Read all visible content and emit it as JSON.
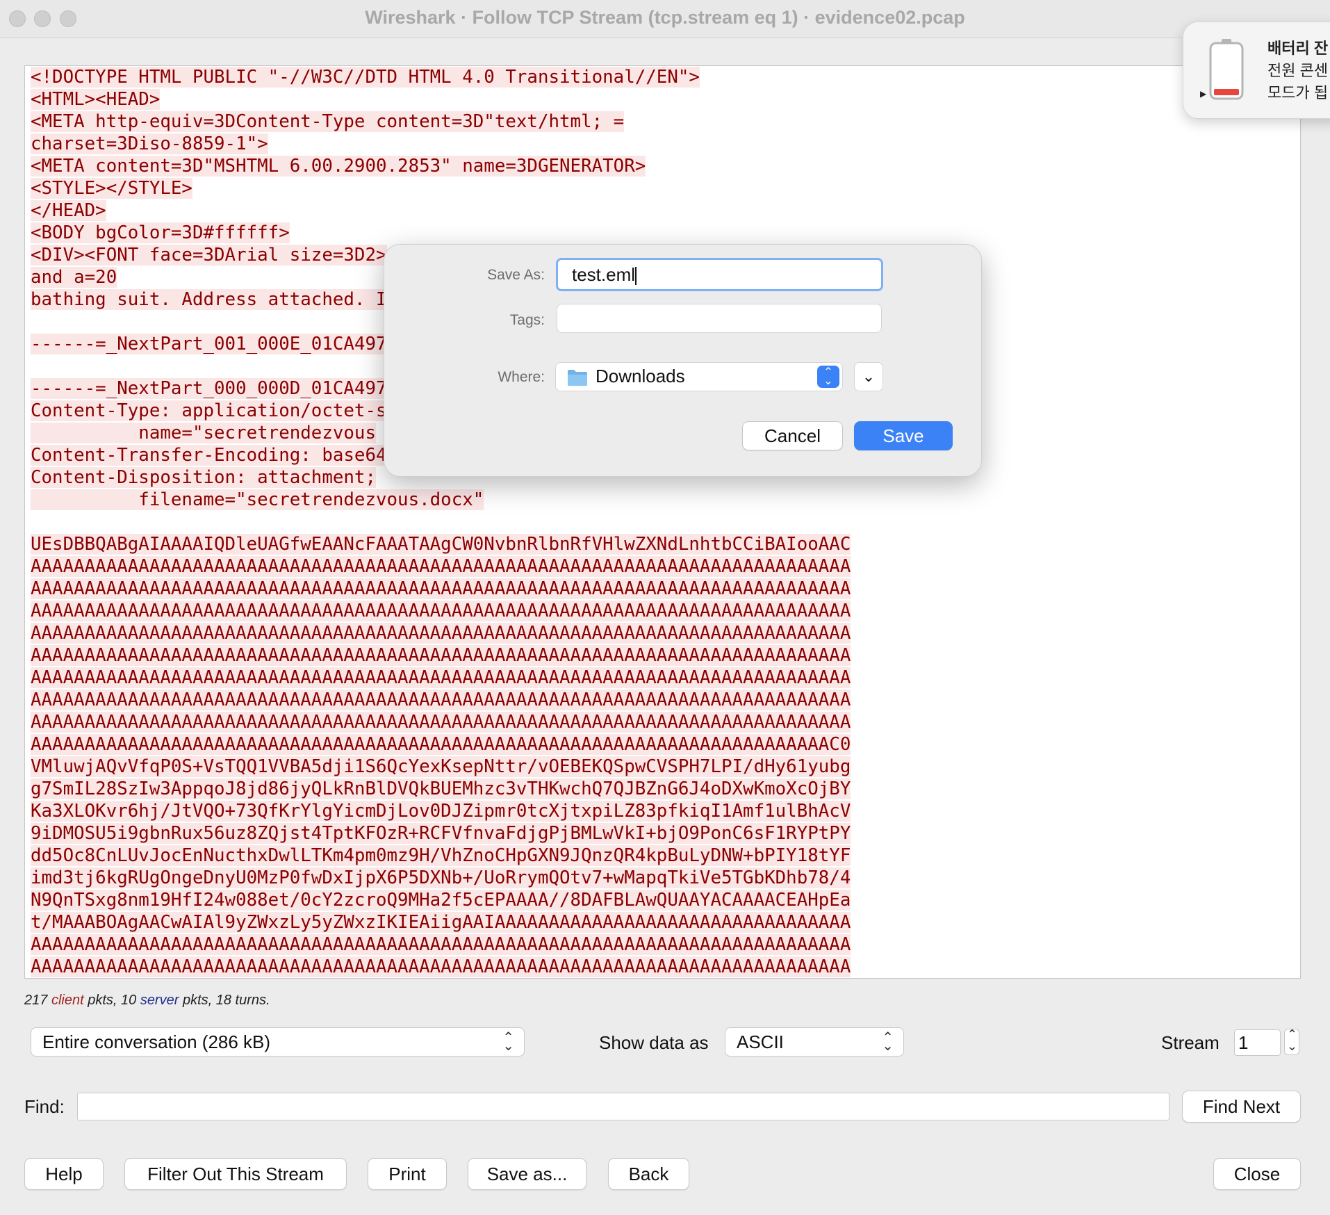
{
  "window": {
    "title": "Wireshark · Follow TCP Stream (tcp.stream eq 1) · evidence02.pcap"
  },
  "stream": {
    "lines": [
      {
        "text": "<!DOCTYPE HTML PUBLIC \"-//W3C//DTD HTML 4.0 Transitional//EN\">",
        "hl": true
      },
      {
        "text": "<HTML><HEAD>",
        "hl": true
      },
      {
        "text": "<META http-equiv=3DContent-Type content=3D\"text/html; =",
        "hl": true
      },
      {
        "text": "charset=3Diso-8859-1\">",
        "hl": true
      },
      {
        "text": "<META content=3D\"MSHTML 6.00.2900.2853\" name=3DGENERATOR>",
        "hl": true
      },
      {
        "text": "<STYLE></STYLE>",
        "hl": true
      },
      {
        "text": "</HEAD>",
        "hl": true
      },
      {
        "text": "<BODY bgColor=3D#ffffff>",
        "hl": true
      },
      {
        "text": "<DIV><FONT face=3DArial size=3D2>",
        "hl": true
      },
      {
        "text": "and a=20",
        "hl": true
      },
      {
        "text": "bathing suit. Address attached. I",
        "hl": true
      },
      {
        "text": "",
        "hl": false
      },
      {
        "text": "------=_NextPart_001_000E_01CA497",
        "hl": true
      },
      {
        "text": "",
        "hl": false
      },
      {
        "text": "------=_NextPart_000_000D_01CA497",
        "hl": true
      },
      {
        "text": "Content-Type: application/octet-s",
        "hl": true
      },
      {
        "text": "          name=\"secretrendezvous",
        "hl": true
      },
      {
        "text": "Content-Transfer-Encoding: base64",
        "hl": true
      },
      {
        "text": "Content-Disposition: attachment;",
        "hl": true
      },
      {
        "text": "          filename=\"secretrendezvous.docx\"",
        "hl": true
      },
      {
        "text": "",
        "hl": false
      },
      {
        "text": "UEsDBBQABgAIAAAAIQDleUAGfwEAANcFAAATAAgCW0NvbnRlbnRfVHlwZXNdLnhtbCCiBAIooAAC",
        "hl": true
      },
      {
        "text": "AAAAAAAAAAAAAAAAAAAAAAAAAAAAAAAAAAAAAAAAAAAAAAAAAAAAAAAAAAAAAAAAAAAAAAAAAAAA",
        "hl": true
      },
      {
        "text": "AAAAAAAAAAAAAAAAAAAAAAAAAAAAAAAAAAAAAAAAAAAAAAAAAAAAAAAAAAAAAAAAAAAAAAAAAAAA",
        "hl": true
      },
      {
        "text": "AAAAAAAAAAAAAAAAAAAAAAAAAAAAAAAAAAAAAAAAAAAAAAAAAAAAAAAAAAAAAAAAAAAAAAAAAAAA",
        "hl": true
      },
      {
        "text": "AAAAAAAAAAAAAAAAAAAAAAAAAAAAAAAAAAAAAAAAAAAAAAAAAAAAAAAAAAAAAAAAAAAAAAAAAAAA",
        "hl": true
      },
      {
        "text": "AAAAAAAAAAAAAAAAAAAAAAAAAAAAAAAAAAAAAAAAAAAAAAAAAAAAAAAAAAAAAAAAAAAAAAAAAAAA",
        "hl": true
      },
      {
        "text": "AAAAAAAAAAAAAAAAAAAAAAAAAAAAAAAAAAAAAAAAAAAAAAAAAAAAAAAAAAAAAAAAAAAAAAAAAAAA",
        "hl": true
      },
      {
        "text": "AAAAAAAAAAAAAAAAAAAAAAAAAAAAAAAAAAAAAAAAAAAAAAAAAAAAAAAAAAAAAAAAAAAAAAAAAAAA",
        "hl": true
      },
      {
        "text": "AAAAAAAAAAAAAAAAAAAAAAAAAAAAAAAAAAAAAAAAAAAAAAAAAAAAAAAAAAAAAAAAAAAAAAAAAAAA",
        "hl": true
      },
      {
        "text": "AAAAAAAAAAAAAAAAAAAAAAAAAAAAAAAAAAAAAAAAAAAAAAAAAAAAAAAAAAAAAAAAAAAAAAAAAAC0",
        "hl": true
      },
      {
        "text": "VMluwjAQvVfqP0S+VsTQQ1VVBA5dji1S6QcYexKsepNttr/vOEBEKQSpwCVSPH7LPI/dHy61yubg",
        "hl": true
      },
      {
        "text": "g7SmIL28SzIw3AppqoJ8jd86jyQLkRnBlDVQkBUEMhzc3vTHKwchQ7QJBZnG6J4oDXwKmoXcOjBY",
        "hl": true
      },
      {
        "text": "Ka3XLOKvr6hj/JtVQO+73QfKrYlgYicmDjLov0DJZipmr0tcXjtxpiLZ83pfkiqI1Amf1ulBhAcV",
        "hl": true
      },
      {
        "text": "9iDMOSU5i9gbnRux56uz8ZQjst4TptKFOzR+RCFVfnvaFdjgPjBMLwVkI+bjO9PonC6sF1RYPtPY",
        "hl": true
      },
      {
        "text": "dd5Oc8CnLUvJocEnNucthxDwlLTKm4pm0mz9H/VhZnoCHpGXN9JQnzQR4kpBuLyDNW+bPIY18tYF",
        "hl": true
      },
      {
        "text": "imd3tj6kgRUgOngeDnyU0MzP0fwDxIjpX6P5DXNb+/UoRrymQOtv7+wMapqTkiVe5TGbKDhb78/4",
        "hl": true
      },
      {
        "text": "N9QnTSxg8nm19HfI24w088et/0cY2zcroQ9MHa2f5cEPAAAA//8DAFBLAwQUAAYACAAAACEAHpEa",
        "hl": true
      },
      {
        "text": "t/MAAABOAgAACwAIAl9yZWxzLy5yZWxzIKIEAiigAAIAAAAAAAAAAAAAAAAAAAAAAAAAAAAAAAAA",
        "hl": true
      },
      {
        "text": "AAAAAAAAAAAAAAAAAAAAAAAAAAAAAAAAAAAAAAAAAAAAAAAAAAAAAAAAAAAAAAAAAAAAAAAAAAAA",
        "hl": true
      },
      {
        "text": "AAAAAAAAAAAAAAAAAAAAAAAAAAAAAAAAAAAAAAAAAAAAAAAAAAAAAAAAAAAAAAAAAAAAAAAAAAAA",
        "hl": true
      }
    ]
  },
  "summary": {
    "client_count": "217",
    "client_word": "client",
    "pkts1": "pkts, 10",
    "server_word": "server",
    "pkts2": "pkts, 18 turns."
  },
  "controls": {
    "conversation_select": "Entire conversation (286 kB)",
    "show_data_as_label": "Show data as",
    "show_data_as_value": "ASCII",
    "stream_label": "Stream",
    "stream_value": "1",
    "find_label": "Find:",
    "find_value": "",
    "find_next": "Find Next"
  },
  "buttons": {
    "help": "Help",
    "filter_out": "Filter Out This Stream",
    "print": "Print",
    "save_as": "Save as...",
    "back": "Back",
    "close": "Close"
  },
  "save_dialog": {
    "save_as_label": "Save As:",
    "save_as_value": "test.eml",
    "tags_label": "Tags:",
    "tags_value": "",
    "where_label": "Where:",
    "where_value": "Downloads",
    "cancel": "Cancel",
    "save": "Save"
  },
  "notification": {
    "line1": "배터리 잔",
    "line2": "전원 콘센",
    "line3": "모드가 됩"
  },
  "colors": {
    "stream_text": "#8b0000",
    "stream_highlight": "#fbe6e6",
    "accent": "#3b82f6"
  }
}
